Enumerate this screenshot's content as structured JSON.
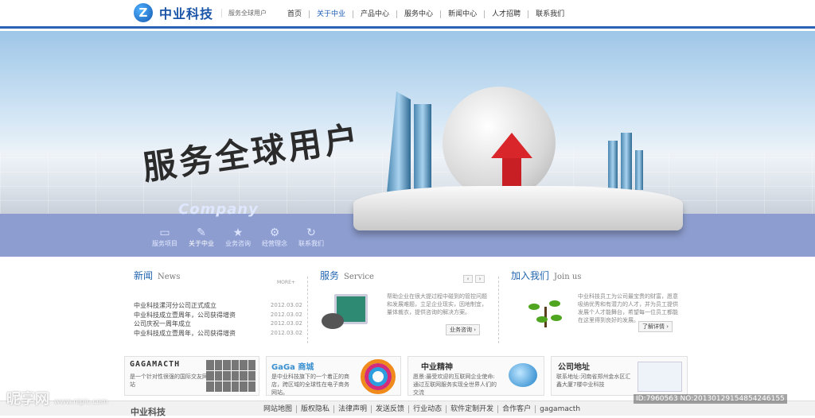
{
  "header": {
    "logo_mark": "Z",
    "logo_text": "中业科技",
    "slogan": "服务全球用户",
    "nav": [
      {
        "label": "首页"
      },
      {
        "label": "关于中业",
        "active": true
      },
      {
        "label": "产品中心"
      },
      {
        "label": "服务中心"
      },
      {
        "label": "新闻中心"
      },
      {
        "label": "人才招聘"
      },
      {
        "label": "联系我们"
      }
    ]
  },
  "banner": {
    "slogan": "服务全球用户",
    "company": "Company",
    "nav": [
      {
        "label": "服务项目",
        "icon": "monitor-icon"
      },
      {
        "label": "关于中业",
        "icon": "pencil-icon",
        "active": true
      },
      {
        "label": "业务咨询",
        "icon": "star-icon"
      },
      {
        "label": "经营理念",
        "icon": "gear-icon"
      },
      {
        "label": "联系我们",
        "icon": "refresh-icon"
      }
    ]
  },
  "news": {
    "title": "新闻",
    "title_en": "News",
    "more": "MORE+",
    "items": [
      {
        "title": "中业科技漯河分公司正式成立",
        "date": "2012.03.02"
      },
      {
        "title": "中业科技成立壹周年，公司获得增资",
        "date": "2012.03.02"
      },
      {
        "title": "公司庆祝一周年成立",
        "date": "2012.03.02"
      },
      {
        "title": "中业科技成立壹周年，公司获得增资",
        "date": "2012.03.02"
      }
    ]
  },
  "service": {
    "title": "服务",
    "title_en": "Service",
    "prev": "‹",
    "next": "›",
    "text": "帮助企业在很大提过程中碰到的管控问题和发展难题，立足企业现实，因地制宜，量体裁衣，提供咨询的解决方案。",
    "button": "业务咨询 ›"
  },
  "join": {
    "title": "加入我们",
    "title_en": "Join us",
    "text": "中业科技员工为公司最宝贵的财富，愿意吸纳优秀和有潜力的人才，并为员工提供发展个人才能舞台，希望每一位员工都能在这里得到良好的发展。",
    "button": "了解详情 ›"
  },
  "cards": [
    {
      "title": "GAGAMACTH",
      "text": "是一个针对性很强的国际交友网站"
    },
    {
      "title": "GaGa 商城",
      "text": "是中业科技旗下的一个着正的商店，跨区域的全球性在电子商务网站。"
    },
    {
      "title": "中业精神",
      "text": "愿景:最受欢迎的互联网企业使命:通过互联网服务实现全世界人们的交流"
    },
    {
      "title": "公司地址",
      "text": "联系地址:河南省郑州金水区汇鑫大厦7楼中业科技"
    }
  ],
  "footer": {
    "logo": "中业科技",
    "links": [
      "网站地图",
      "版权隐私",
      "法律声明",
      "发送反馈",
      "行业动态",
      "软件定制开发",
      "合作客户",
      "gagamacth"
    ]
  },
  "watermark": {
    "left": "昵享网",
    "left_url": "www.nipic.com",
    "right": "ID:7960563 NO:20130129154854246155"
  }
}
